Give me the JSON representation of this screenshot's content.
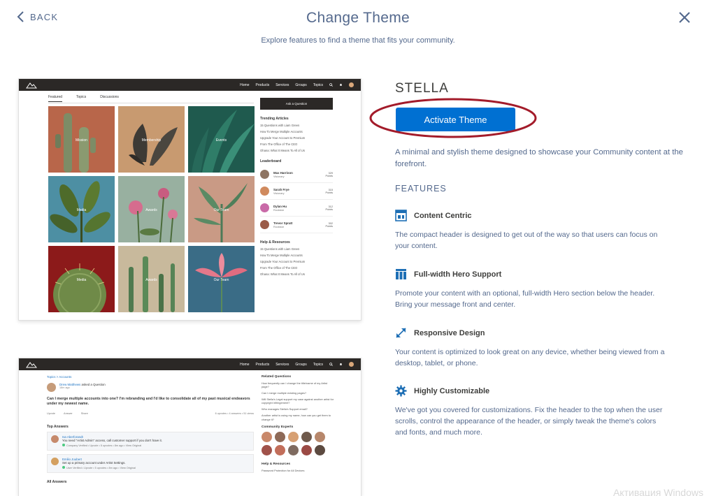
{
  "header": {
    "back_label": "BACK",
    "title": "Change Theme",
    "subtitle": "Explore features to find a theme that fits your community."
  },
  "preview_nav": {
    "links": [
      "Home",
      "Products",
      "Services",
      "Groups",
      "Topics"
    ]
  },
  "preview1": {
    "tabs": [
      "Featured",
      "Topics",
      "Discussions"
    ],
    "tiles": [
      "Mission",
      "Membership",
      "Events",
      "Media",
      "Awards",
      "Our Team",
      "Media",
      "Awards",
      "Our Team"
    ],
    "ask_button": "Ask a Question",
    "trending_title": "Trending Articles",
    "trending": [
      "15 Questions with Liam Green",
      "How To Merge Multiple Accounts",
      "Upgrade Your Account to Premium",
      "From The Office of The CEO",
      "Ohana: What It Means To All of Us"
    ],
    "leaderboard_title": "Leaderboard",
    "leaderboard": [
      {
        "name": "Max Harrison",
        "role": "Visionary",
        "points": "329",
        "points_label": "Points"
      },
      {
        "name": "Sarah Frye",
        "role": "Visionary",
        "points": "315",
        "points_label": "Points"
      },
      {
        "name": "Dylan Hu",
        "role": "Rockstar",
        "points": "312",
        "points_label": "Points"
      },
      {
        "name": "Trevor Spratt",
        "role": "Rockstar",
        "points": "302",
        "points_label": "Points"
      }
    ],
    "help_title": "Help & Resources",
    "help": [
      "15 Questions with Liam Green",
      "How To Merge Multiple Accounts",
      "Upgrade Your Account to Premium",
      "From The Office of The CEO",
      "Ohana: What It Means To All of Us"
    ]
  },
  "preview2": {
    "breadcrumb": "Topics > Accounts",
    "asker": "Drew Matthews",
    "asked": "asked a Question",
    "asked_time": "18m ago",
    "question": "Can I merge multiple accounts into one? I'm rebranding and I'd like to consolidate all of my past musical endeavors under my newest name.",
    "actions": [
      "Upvote",
      "Answer",
      "Share"
    ],
    "stats": "6 upvotes • 4 answers • 51 views",
    "top_answers_title": "Top Answers",
    "answers": [
      {
        "name": "Isa Aberforandt",
        "text": "You need \"Artist Admin\" access, call customer support if you don't have it.",
        "meta": "Company Verified • Upvote • 5 upvotes • 8m ago • View Original"
      },
      {
        "name": "Emilio Joubert",
        "text": "Set up a primary account under Artist Settings.",
        "meta": "User Verified • Upvote • 5 upvotes • 8m ago • View Original"
      }
    ],
    "all_answers_title": "All Answers",
    "related_title": "Related Questions",
    "related": [
      "How frequently can I change the title/name of my Artist page?",
      "Can I merge multiple existing pages?",
      "Will Stella's Legal support my case against another artist for copyright infringement?",
      "Who manages Stella's Support email?",
      "Another artist is using my name, how can you get them to change it?"
    ],
    "experts_title": "Community Experts",
    "help_title": "Help & Resources",
    "help": [
      "Password Protection for All Devices"
    ]
  },
  "theme": {
    "name": "STELLA",
    "activate_label": "Activate Theme",
    "description": "A minimal and stylish theme designed to showcase your Community content at the forefront.",
    "features_title": "FEATURES",
    "features": [
      {
        "title": "Content Centric",
        "body": "The compact header is designed to get out of the way so that users can focus on your content."
      },
      {
        "title": "Full-width Hero Support",
        "body": "Promote your content with an optional, full-width Hero section below the header. Bring your message front and center."
      },
      {
        "title": "Responsive Design",
        "body": "Your content is optimized to look great on any device, whether being viewed from a desktop, tablet, or phone."
      },
      {
        "title": "Highly Customizable",
        "body": "We've got you covered for customizations. Fix the header to the top when the user scrolls, control the appearance of the header, or simply tweak the theme's colors and fonts, and much more."
      }
    ]
  },
  "watermark": "Активация Windows",
  "icons": {
    "back": "chevron-left-icon",
    "close": "close-icon",
    "features": [
      "layout-icon",
      "hero-columns-icon",
      "expand-arrows-icon",
      "gear-icon"
    ]
  },
  "colors": {
    "accent": "#0070d2",
    "highlight_ellipse": "#a31b2a",
    "nav_dark": "#2b2826",
    "text_muted": "#54698d"
  }
}
